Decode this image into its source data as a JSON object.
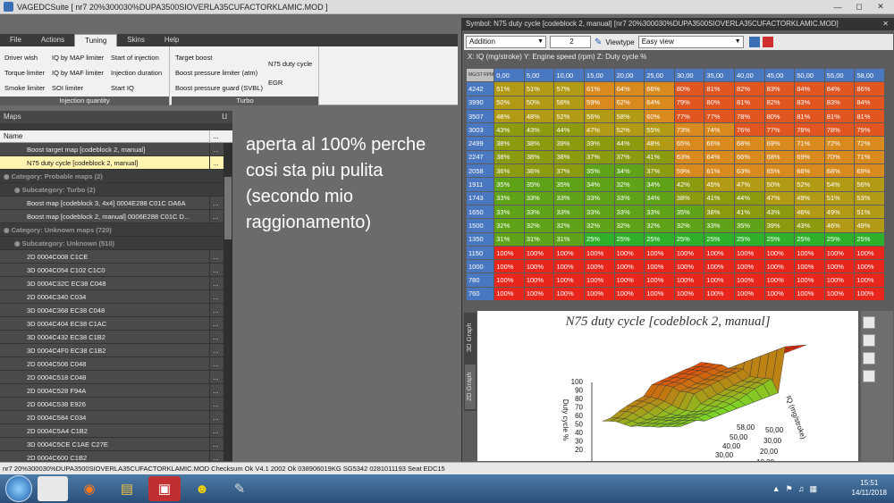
{
  "window": {
    "title": "VAGEDCSuite [ nr7 20%300030%DUPA3500SIOVERLA35CUFACTORKLAMIC.MOD ]"
  },
  "menu": [
    "File",
    "Actions",
    "Tuning",
    "Skins",
    "Help"
  ],
  "ribbon": {
    "injection_group": {
      "label": "Injection quantity",
      "items": [
        "Driver wish",
        "IQ by MAP limiter",
        "Start of injection",
        "Torque limiter",
        "IQ by MAF limiter",
        "Injection duration",
        "Smoke limiter",
        "SOI limiter",
        "Start IQ"
      ]
    },
    "turbo_group": {
      "label": "Turbo",
      "items": [
        "Target boost",
        "Boost pressure limiter (atm)",
        "Boost pressure guard (SVBL)",
        "N75 duty cycle",
        "EGR"
      ]
    }
  },
  "maps_panel": {
    "title": "Maps",
    "col_name": "Name",
    "rows": [
      {
        "label": "Boost target map [codeblock 2, manual]",
        "type": "item"
      },
      {
        "label": "N75 duty cycle [codeblock 2, manual]",
        "type": "selected"
      },
      {
        "label": "Category: Probable maps (2)",
        "type": "cat"
      },
      {
        "label": "Subcategory: Turbo (2)",
        "type": "subcat"
      },
      {
        "label": "Boost map [codeblock 3, 4x4] 0004E288 C01C DA6A",
        "type": "item"
      },
      {
        "label": "Boost map [codeblock 2, manual] 0006E288 C01C D...",
        "type": "item"
      },
      {
        "label": "Category: Unknown maps (720)",
        "type": "cat"
      },
      {
        "label": "Subcategory: Unknown (510)",
        "type": "subcat"
      },
      {
        "label": "2D 0004C008 C1CE",
        "type": "item"
      },
      {
        "label": "3D 0004C054 C102 C1C0",
        "type": "item"
      },
      {
        "label": "3D 0004C32C EC38 C048",
        "type": "item"
      },
      {
        "label": "2D 0004C340 C034",
        "type": "item"
      },
      {
        "label": "3D 0004C368 EC38 C048",
        "type": "item"
      },
      {
        "label": "3D 0004C404 EC38 C1AC",
        "type": "item"
      },
      {
        "label": "3D 0004C432 EC38 C1B2",
        "type": "item"
      },
      {
        "label": "3D 0004C4F0 EC38 C1B2",
        "type": "item"
      },
      {
        "label": "2D 0004C506 C048",
        "type": "item"
      },
      {
        "label": "2D 0004C518 C048",
        "type": "item"
      },
      {
        "label": "2D 0004C528 F94A",
        "type": "item"
      },
      {
        "label": "2D 0004C538 E926",
        "type": "item"
      },
      {
        "label": "2D 0004C584 C034",
        "type": "item"
      },
      {
        "label": "2D 0004C5A4 C1B2",
        "type": "item"
      },
      {
        "label": "3D 0004C5CE C1AE C27E",
        "type": "item"
      },
      {
        "label": "2D 0004C600 C1B2",
        "type": "item"
      }
    ]
  },
  "note": "aperta al 100% perche cosi sta piu pulita (secondo mio raggionamento)",
  "symbol_window": {
    "title": "Symbol: N75 duty cycle [codeblock 2, manual] [nr7 20%300030%DUPA3500SIOVERLA35CUFACTORKLAMIC.MOD]",
    "mode": "Addition",
    "value": "2",
    "viewtype_label": "Viewtype",
    "viewtype": "Easy view",
    "axis_info": "X: IQ (mg/stroke) Y: Engine speed (rpm) Z: Duty cycle %",
    "corner": "MG/ST RPM",
    "graph_tabs": [
      "3D Graph",
      "2D Graph"
    ]
  },
  "map": {
    "x": [
      "0,00",
      "5,00",
      "10,00",
      "15,00",
      "20,00",
      "25,00",
      "30,00",
      "35,00",
      "40,00",
      "45,00",
      "50,00",
      "55,00",
      "58,00"
    ],
    "y": [
      "4242",
      "3990",
      "3507",
      "3003",
      "2499",
      "2247",
      "2058",
      "1911",
      "1743",
      "1650",
      "1500",
      "1350",
      "1150",
      "1000",
      "780",
      "760"
    ],
    "z": [
      [
        51,
        51,
        57,
        61,
        64,
        66,
        80,
        81,
        82,
        83,
        84,
        84,
        86
      ],
      [
        50,
        50,
        56,
        59,
        62,
        64,
        79,
        80,
        81,
        82,
        83,
        83,
        84
      ],
      [
        48,
        48,
        52,
        56,
        58,
        60,
        77,
        77,
        78,
        80,
        81,
        81,
        81
      ],
      [
        43,
        43,
        44,
        47,
        52,
        55,
        73,
        74,
        76,
        77,
        78,
        78,
        79
      ],
      [
        38,
        38,
        39,
        39,
        44,
        48,
        65,
        66,
        68,
        69,
        71,
        72,
        72
      ],
      [
        38,
        38,
        38,
        37,
        37,
        41,
        63,
        64,
        66,
        68,
        69,
        70,
        71
      ],
      [
        36,
        36,
        37,
        35,
        34,
        37,
        59,
        61,
        63,
        65,
        66,
        68,
        69
      ],
      [
        35,
        35,
        35,
        34,
        32,
        34,
        42,
        45,
        47,
        50,
        52,
        54,
        56
      ],
      [
        33,
        33,
        33,
        33,
        33,
        34,
        38,
        41,
        44,
        47,
        49,
        51,
        53
      ],
      [
        33,
        33,
        33,
        33,
        33,
        33,
        35,
        38,
        41,
        43,
        46,
        49,
        51
      ],
      [
        32,
        32,
        32,
        32,
        32,
        32,
        32,
        33,
        35,
        39,
        43,
        46,
        49
      ],
      [
        31,
        31,
        31,
        25,
        25,
        25,
        25,
        25,
        25,
        25,
        25,
        25,
        25
      ],
      [
        100,
        100,
        100,
        100,
        100,
        100,
        100,
        100,
        100,
        100,
        100,
        100,
        100
      ],
      [
        100,
        100,
        100,
        100,
        100,
        100,
        100,
        100,
        100,
        100,
        100,
        100,
        100
      ],
      [
        100,
        100,
        100,
        100,
        100,
        100,
        100,
        100,
        100,
        100,
        100,
        100,
        100
      ],
      [
        100,
        100,
        100,
        100,
        100,
        100,
        100,
        100,
        100,
        100,
        100,
        100,
        100
      ]
    ],
    "unit_suffix": "%"
  },
  "chart_data": {
    "type": "surface",
    "title": "N75 duty cycle [codeblock 2, manual]",
    "zlabel": "Duty cycle %",
    "xlabel": "IQ (mg/stroke)",
    "z_ticks": [
      "100",
      "90",
      "80",
      "70",
      "60",
      "50",
      "40",
      "30",
      "20"
    ],
    "rpm_ticks": [
      "4242",
      "2499",
      "1743",
      "1150"
    ],
    "iq_ticks": [
      "58,00",
      "50,00",
      "40,00",
      "30,00",
      "20,00",
      "10,00",
      "0,00"
    ],
    "iq_ticks_right": [
      "50,00",
      "30,00",
      "20,00",
      "10,00",
      "0,00"
    ]
  },
  "statusbar": "nr7 20%300030%DUPA3500SIOVERLA35CUFACTORKLAMIC.MOD   Checksum Ok V4.1 2002   Ok  038906019KG SG5342   0281011193 Seat EDC15",
  "clock": {
    "time": "15:51",
    "date": "14/11/2018"
  }
}
